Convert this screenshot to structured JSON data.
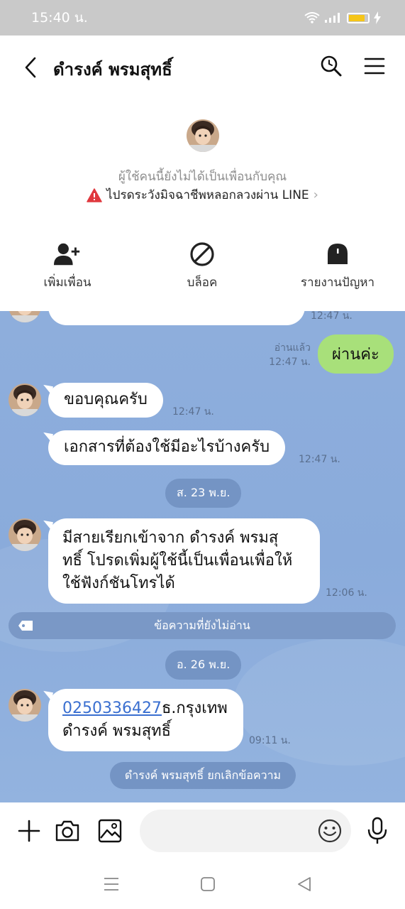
{
  "status_bar": {
    "time": "15:40 น."
  },
  "header": {
    "title": "ดำรงค์ พรมสุทธิ์",
    "back_icon": "chevron-left-icon",
    "search_icon": "search-icon",
    "menu_icon": "hamburger-menu-icon"
  },
  "profile": {
    "not_friend_text": "ผู้ใช้คนนี้ยังไม่ได้เป็นเพื่อนกับคุณ",
    "warning_text": "ไปรดระวังมิจฉาชีพหลอกลวงผ่าน LINE",
    "actions": [
      {
        "label": "เพิ่มเพื่อน",
        "icon": "add-friend-icon"
      },
      {
        "label": "บล็อค",
        "icon": "block-icon"
      },
      {
        "label": "รายงานปัญหา",
        "icon": "report-icon"
      }
    ]
  },
  "chat": {
    "messages": [
      {
        "type": "in",
        "text": "",
        "time": "12:47 น."
      },
      {
        "type": "out",
        "text": "ผ่านค่ะ",
        "read_label": "อ่านแล้ว",
        "time": "12:47 น."
      },
      {
        "type": "in",
        "text": "ขอบคุณครับ",
        "time": "12:47 น."
      },
      {
        "type": "in",
        "text": "เอกสารที่ต้องใช้มีอะไรบ้างครับ",
        "time": "12:47 น."
      },
      {
        "type": "date",
        "text": "ส. 23 พ.ย."
      },
      {
        "type": "in",
        "lines": [
          "มีสายเรียกเข้าจาก ดำรงค์ พรมสุ",
          "ทธิ์ โปรดเพิ่มผู้ใช้นี้เป็นเพื่อนเพื่อให้",
          "ใช้ฟังก์ชันโทรได้"
        ],
        "time": "12:06 น."
      },
      {
        "type": "unread",
        "text": "ข้อความที่ยังไม่อ่าน"
      },
      {
        "type": "date",
        "text": "อ. 26 พ.ย."
      },
      {
        "type": "in",
        "link": "0250336427",
        "line1_rest": "ธ.กรุงเทพ",
        "line2": "ดำรงค์ พรมสุทธิ์",
        "time": "09:11 น."
      },
      {
        "type": "system",
        "text": "ดำรงค์ พรมสุทธิ์ ยกเลิกข้อความ"
      }
    ]
  },
  "input_bar": {
    "placeholder": "",
    "icons": [
      "plus-icon",
      "camera-icon",
      "image-icon",
      "emoji-icon",
      "microphone-icon"
    ]
  },
  "nav_bar": {
    "icons": [
      "recent-apps-icon",
      "home-icon",
      "back-icon"
    ]
  },
  "colors": {
    "chat_background": "#8aabdb",
    "outgoing_bubble": "#a8e07a",
    "incoming_bubble": "#ffffff",
    "date_pill": "#7494c4",
    "warning_red": "#e0383e"
  }
}
